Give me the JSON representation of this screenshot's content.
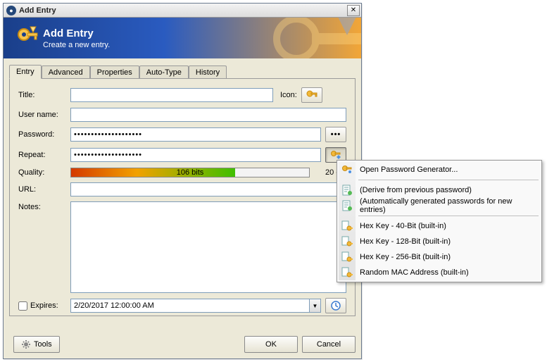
{
  "window": {
    "title": "Add Entry"
  },
  "header": {
    "title": "Add Entry",
    "subtitle": "Create a new entry."
  },
  "tabs": [
    "Entry",
    "Advanced",
    "Properties",
    "Auto-Type",
    "History"
  ],
  "form": {
    "title_label": "Title:",
    "title_value": "",
    "icon_label": "Icon:",
    "username_label": "User name:",
    "username_value": "",
    "password_label": "Password:",
    "password_value": "••••••••••••••••••••",
    "repeat_label": "Repeat:",
    "repeat_value": "••••••••••••••••••••",
    "quality_label": "Quality:",
    "quality_text": "106 bits",
    "char_count": "20 ch.",
    "url_label": "URL:",
    "url_value": "",
    "notes_label": "Notes:",
    "notes_value": "",
    "expires_label": "Expires:",
    "expires_value": "2/20/2017 12:00:00 AM"
  },
  "buttons": {
    "tools": "Tools",
    "ok": "OK",
    "cancel": "Cancel",
    "reveal_dots": "•••"
  },
  "menu": {
    "items": [
      "Open Password Generator...",
      "(Derive from previous password)",
      "(Automatically generated passwords for new entries)",
      "Hex Key - 40-Bit (built-in)",
      "Hex Key - 128-Bit (built-in)",
      "Hex Key - 256-Bit (built-in)",
      "Random MAC Address (built-in)"
    ]
  }
}
